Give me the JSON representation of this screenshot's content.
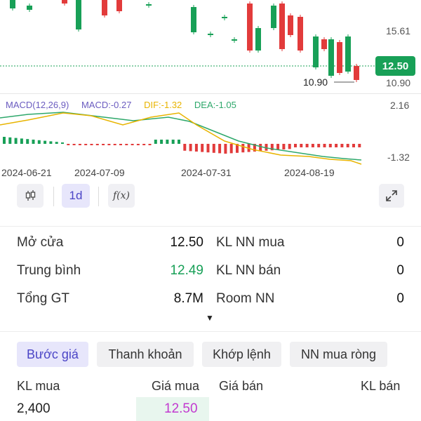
{
  "chart": {
    "price_axis": {
      "top": "15.61",
      "bottom": "10.90"
    },
    "current_price": "12.50",
    "low_marker": "10.90",
    "macd": {
      "indicator": "MACD(12,26,9)",
      "macd_value": "MACD:-0.27",
      "dif_value": "DIF:-1.32",
      "dea_value": "DEA:-1.05",
      "axis_top": "2.16",
      "axis_bottom": "-1.32"
    },
    "dates": [
      "2024-06-21",
      "2024-07-09",
      "2024-07-31",
      "2024-08-19"
    ],
    "colors": {
      "up": "#18a057",
      "down": "#e23b3b",
      "dif": "#e8b400",
      "dea": "#2ea86b",
      "macd_label": "#6b5cc0"
    }
  },
  "toolbar": {
    "interval": "1d",
    "candle_icon": "candlestick-icon",
    "fx_label": "f(x)",
    "expand_icon": "expand-icon"
  },
  "stats": {
    "rows": [
      {
        "left_label": "Mở cửa",
        "left_value": "12.50",
        "right_label": "KL NN mua",
        "right_value": "0"
      },
      {
        "left_label": "Trung bình",
        "left_value": "12.49",
        "right_label": "KL NN bán",
        "right_value": "0"
      },
      {
        "left_label": "Tổng GT",
        "left_value": "8.7M",
        "right_label": "Room NN",
        "right_value": "0"
      }
    ],
    "expand_arrow": "▼"
  },
  "tabs": [
    "Bước giá",
    "Thanh khoản",
    "Khớp lệnh",
    "NN mua ròng"
  ],
  "order_book": {
    "headers": {
      "buy_qty": "KL mua",
      "buy_price": "Giá mua",
      "sell_price": "Giá bán",
      "sell_qty": "KL bán"
    },
    "rows": [
      {
        "buy_qty": "2,400",
        "buy_price": "12.50"
      }
    ]
  }
}
